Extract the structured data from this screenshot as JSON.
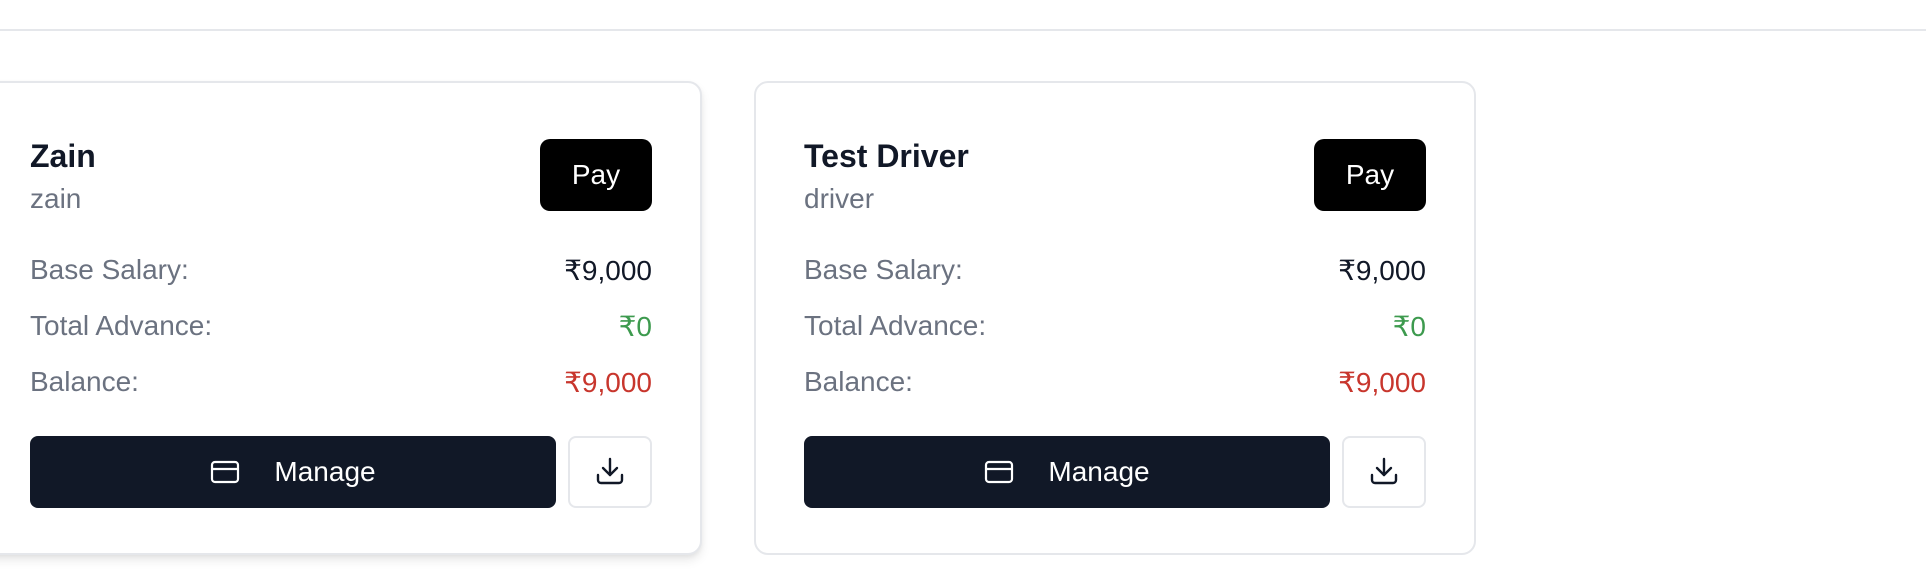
{
  "cards": [
    {
      "name": "Zain",
      "username": "zain",
      "pay_label": "Pay",
      "rows": [
        {
          "label": "Base Salary:",
          "value": "₹9,000"
        },
        {
          "label": "Total Advance:",
          "value": "₹0"
        },
        {
          "label": "Balance:",
          "value": "₹9,000"
        }
      ],
      "manage_label": "Manage",
      "manage_icon": "credit-card-icon",
      "download_icon": "download-icon"
    },
    {
      "name": "Test Driver",
      "username": "driver",
      "pay_label": "Pay",
      "rows": [
        {
          "label": "Base Salary:",
          "value": "₹9,000"
        },
        {
          "label": "Total Advance:",
          "value": "₹0"
        },
        {
          "label": "Balance:",
          "value": "₹9,000"
        }
      ],
      "manage_label": "Manage",
      "manage_icon": "credit-card-icon",
      "download_icon": "download-icon"
    }
  ],
  "colors": {
    "advance_value": "#3d9a4e",
    "balance_value": "#c8362d",
    "manage_button_bg": "#111827",
    "pay_button_bg": "#000000"
  }
}
